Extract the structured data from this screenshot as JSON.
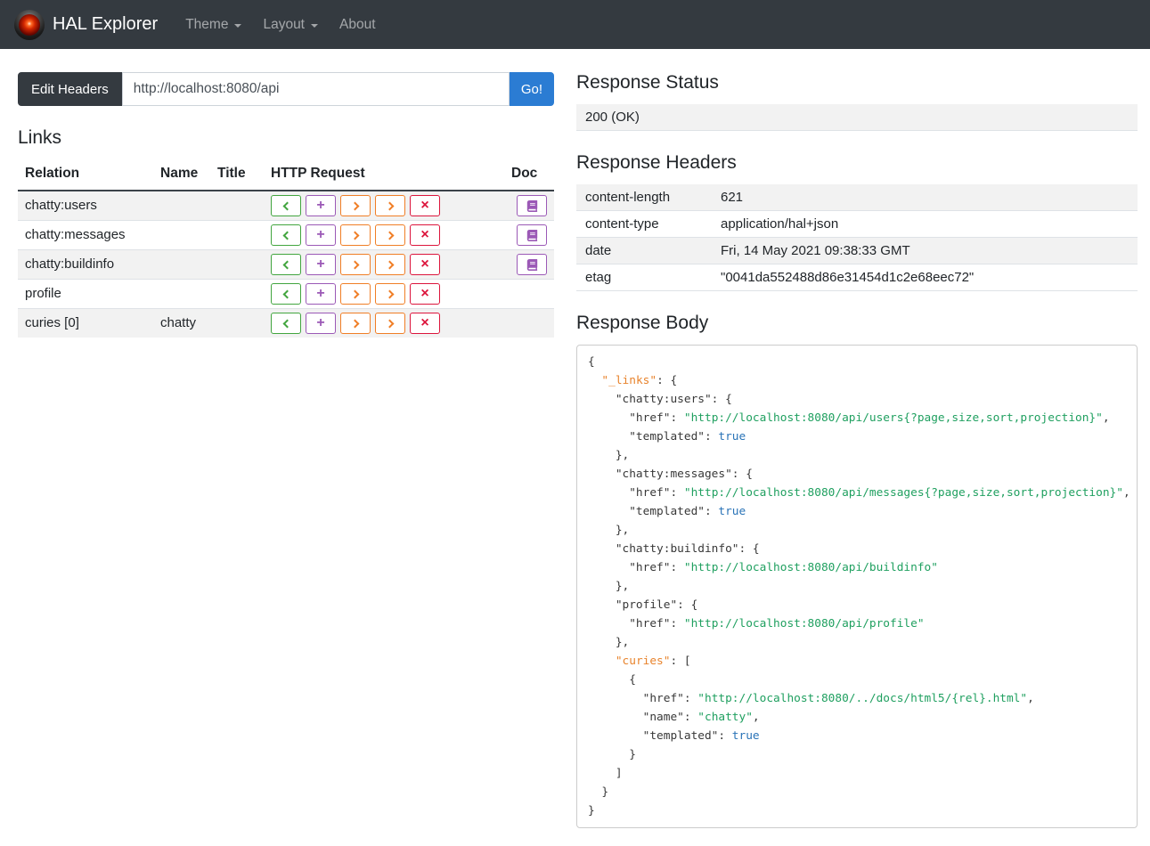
{
  "colors": {
    "navbar_bg": "#343a40",
    "go_button": "#2b7cd3",
    "get": "#42a53f",
    "post": "#9b59b6",
    "put_patch": "#f07e26",
    "delete": "#dc153c",
    "doc": "#9b59b6",
    "stripe": "#f2f2f2",
    "json_key_special": "#e8832c",
    "json_string": "#20a060",
    "json_boolean": "#2973b7"
  },
  "navbar": {
    "brand": "HAL Explorer",
    "items": [
      {
        "label": "Theme",
        "has_dropdown": true
      },
      {
        "label": "Layout",
        "has_dropdown": true
      },
      {
        "label": "About",
        "has_dropdown": false
      }
    ]
  },
  "request_bar": {
    "edit_headers_label": "Edit Headers",
    "url_value": "http://localhost:8080/api",
    "go_label": "Go!"
  },
  "links_section": {
    "title": "Links",
    "columns": [
      "Relation",
      "Name",
      "Title",
      "HTTP Request",
      "Doc"
    ],
    "http_buttons": [
      {
        "name": "get-button",
        "method": "GET",
        "icon": "chevron-left-icon",
        "char": null,
        "color_key": "get"
      },
      {
        "name": "post-button",
        "method": "POST",
        "icon": "plus-icon",
        "char": "+",
        "color_key": "post"
      },
      {
        "name": "put-button",
        "method": "PUT",
        "icon": "chevron-right-icon",
        "char": null,
        "color_key": "put_patch"
      },
      {
        "name": "patch-button",
        "method": "PATCH",
        "icon": "chevron-right-icon",
        "char": null,
        "color_key": "put_patch"
      },
      {
        "name": "delete-button",
        "method": "DELETE",
        "icon": "x-icon",
        "char": "×",
        "color_key": "delete"
      }
    ],
    "rows": [
      {
        "relation": "chatty:users",
        "name": "",
        "title": "",
        "doc": true
      },
      {
        "relation": "chatty:messages",
        "name": "",
        "title": "",
        "doc": true
      },
      {
        "relation": "chatty:buildinfo",
        "name": "",
        "title": "",
        "doc": true
      },
      {
        "relation": "profile",
        "name": "",
        "title": "",
        "doc": false
      },
      {
        "relation": "curies [0]",
        "name": "chatty",
        "title": "",
        "doc": false
      }
    ]
  },
  "response": {
    "status_title": "Response Status",
    "status_value": "200 (OK)",
    "headers_title": "Response Headers",
    "headers": [
      {
        "key": "content-length",
        "value": "621"
      },
      {
        "key": "content-type",
        "value": "application/hal+json"
      },
      {
        "key": "date",
        "value": "Fri, 14 May 2021 09:38:33 GMT"
      },
      {
        "key": "etag",
        "value": "\"0041da552488d86e31454d1c2e68eec72\""
      }
    ],
    "body_title": "Response Body",
    "body_lines": [
      [
        [
          "p",
          "{"
        ]
      ],
      [
        [
          "p",
          "  "
        ],
        [
          "h",
          "\"_links\""
        ],
        [
          "p",
          ": {"
        ]
      ],
      [
        [
          "p",
          "    \"chatty:users\": {"
        ]
      ],
      [
        [
          "p",
          "      \"href\": "
        ],
        [
          "s",
          "\"http://localhost:8080/api/users{?page,size,sort,projection}\""
        ],
        [
          "p",
          ","
        ]
      ],
      [
        [
          "p",
          "      \"templated\": "
        ],
        [
          "b",
          "true"
        ]
      ],
      [
        [
          "p",
          "    },"
        ]
      ],
      [
        [
          "p",
          "    \"chatty:messages\": {"
        ]
      ],
      [
        [
          "p",
          "      \"href\": "
        ],
        [
          "s",
          "\"http://localhost:8080/api/messages{?page,size,sort,projection}\""
        ],
        [
          "p",
          ","
        ]
      ],
      [
        [
          "p",
          "      \"templated\": "
        ],
        [
          "b",
          "true"
        ]
      ],
      [
        [
          "p",
          "    },"
        ]
      ],
      [
        [
          "p",
          "    \"chatty:buildinfo\": {"
        ]
      ],
      [
        [
          "p",
          "      \"href\": "
        ],
        [
          "s",
          "\"http://localhost:8080/api/buildinfo\""
        ]
      ],
      [
        [
          "p",
          "    },"
        ]
      ],
      [
        [
          "p",
          "    \"profile\": {"
        ]
      ],
      [
        [
          "p",
          "      \"href\": "
        ],
        [
          "s",
          "\"http://localhost:8080/api/profile\""
        ]
      ],
      [
        [
          "p",
          "    },"
        ]
      ],
      [
        [
          "p",
          "    "
        ],
        [
          "h",
          "\"curies\""
        ],
        [
          "p",
          ": ["
        ]
      ],
      [
        [
          "p",
          "      {"
        ]
      ],
      [
        [
          "p",
          "        \"href\": "
        ],
        [
          "s",
          "\"http://localhost:8080/../docs/html5/{rel}.html\""
        ],
        [
          "p",
          ","
        ]
      ],
      [
        [
          "p",
          "        \"name\": "
        ],
        [
          "s",
          "\"chatty\""
        ],
        [
          "p",
          ","
        ]
      ],
      [
        [
          "p",
          "        \"templated\": "
        ],
        [
          "b",
          "true"
        ]
      ],
      [
        [
          "p",
          "      }"
        ]
      ],
      [
        [
          "p",
          "    ]"
        ]
      ],
      [
        [
          "p",
          "  }"
        ]
      ],
      [
        [
          "p",
          "}"
        ]
      ]
    ]
  }
}
